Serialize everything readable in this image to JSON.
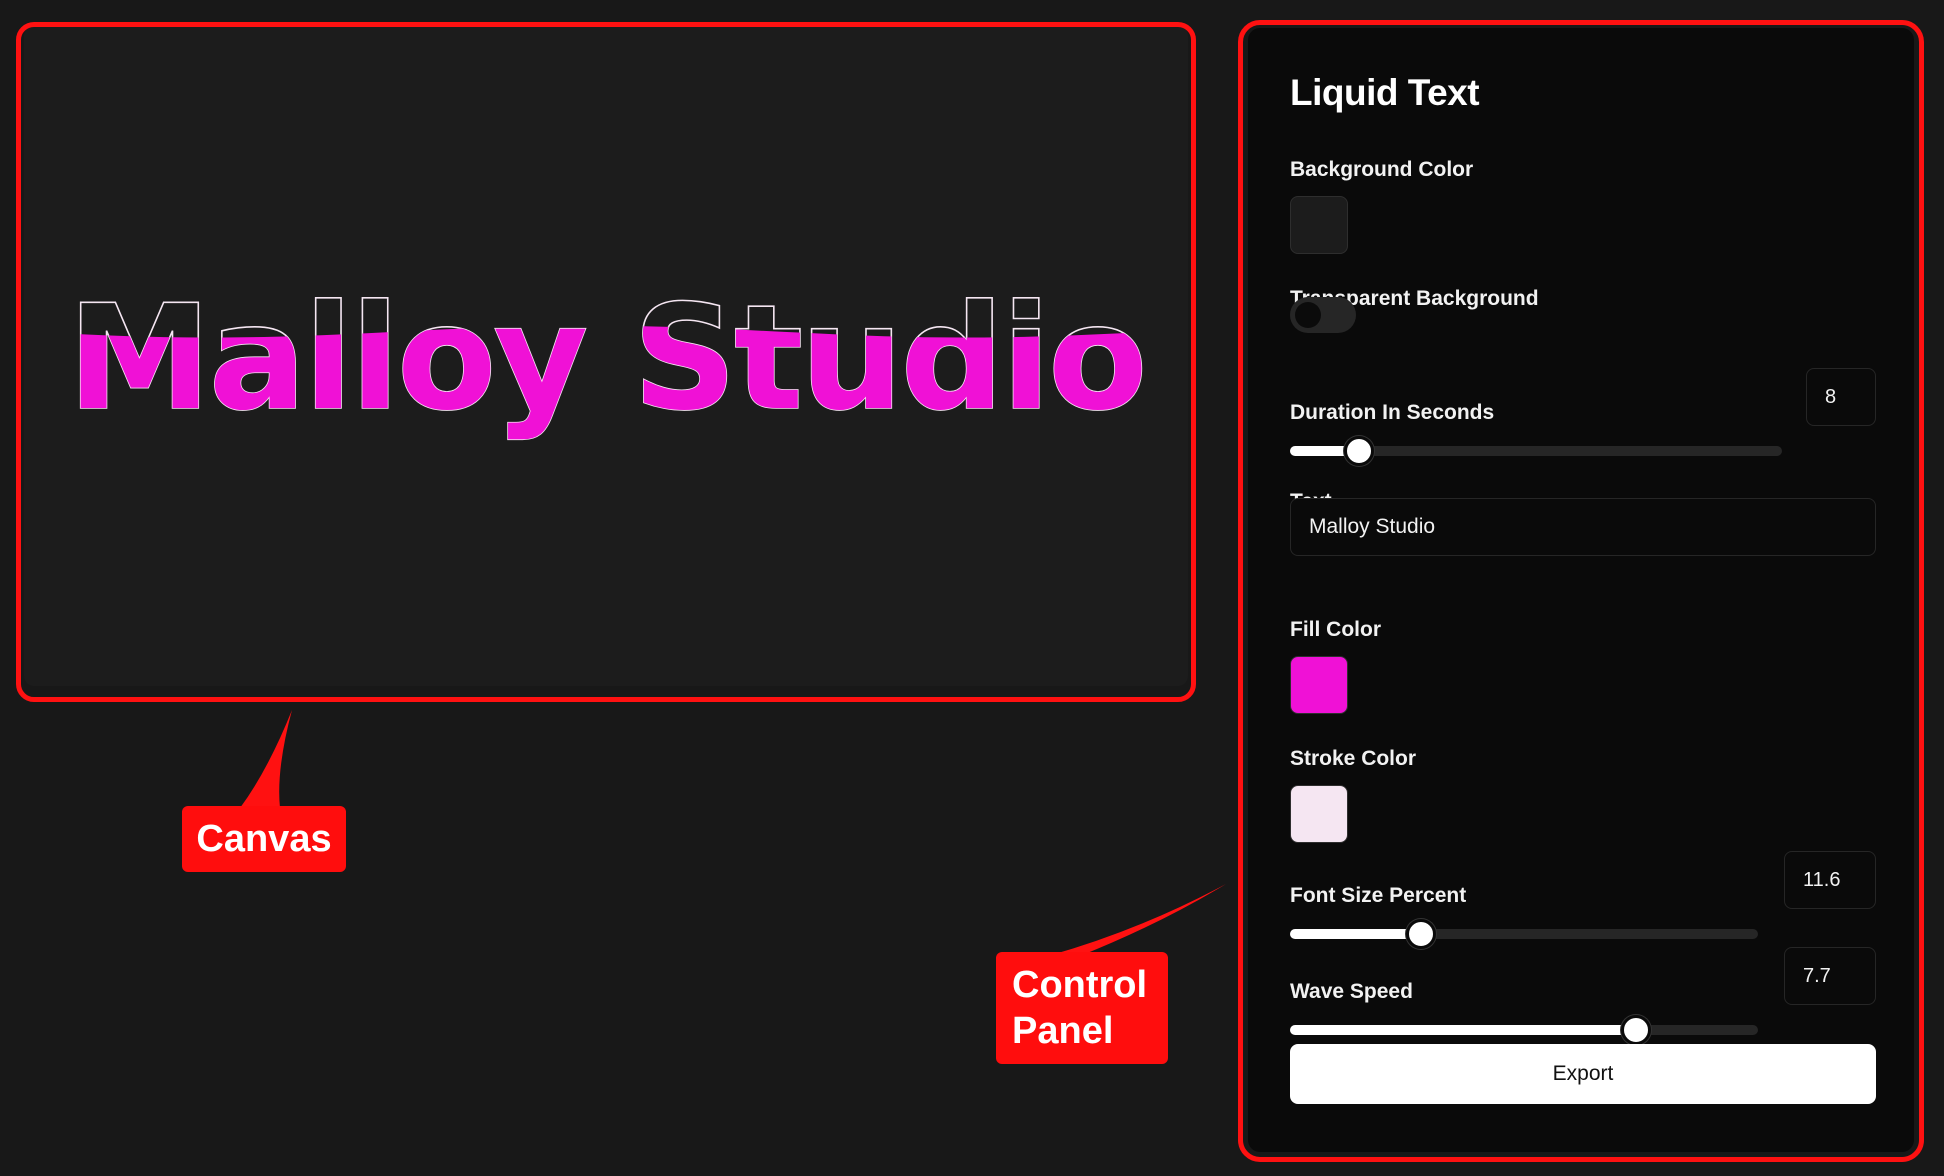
{
  "canvas": {
    "text": "Malloy Studio",
    "fill_color": "#f011d6",
    "stroke_color": "#f5e6f2",
    "background_color": "#1c1c1c",
    "fill_level": 0.55
  },
  "panel": {
    "title": "Liquid Text",
    "background_color": {
      "label": "Background Color",
      "value": "#1c1c1c"
    },
    "transparent_background": {
      "label": "Transparent Background",
      "enabled": false
    },
    "duration": {
      "label": "Duration In Seconds",
      "value": "8",
      "fraction": 0.14
    },
    "text": {
      "label": "Text",
      "value": "Malloy Studio"
    },
    "fill_color": {
      "label": "Fill Color",
      "value": "#f011d6"
    },
    "stroke_color": {
      "label": "Stroke Color",
      "value": "#f5e6f2"
    },
    "font_size": {
      "label": "Font Size Percent",
      "value": "11.6",
      "fraction": 0.28
    },
    "wave_speed": {
      "label": "Wave Speed",
      "value": "7.7",
      "fraction": 0.74
    },
    "export_label": "Export"
  },
  "annotations": {
    "canvas_label": "Canvas",
    "panel_label_line1": "Control",
    "panel_label_line2": "Panel",
    "color": "#ff1111"
  }
}
